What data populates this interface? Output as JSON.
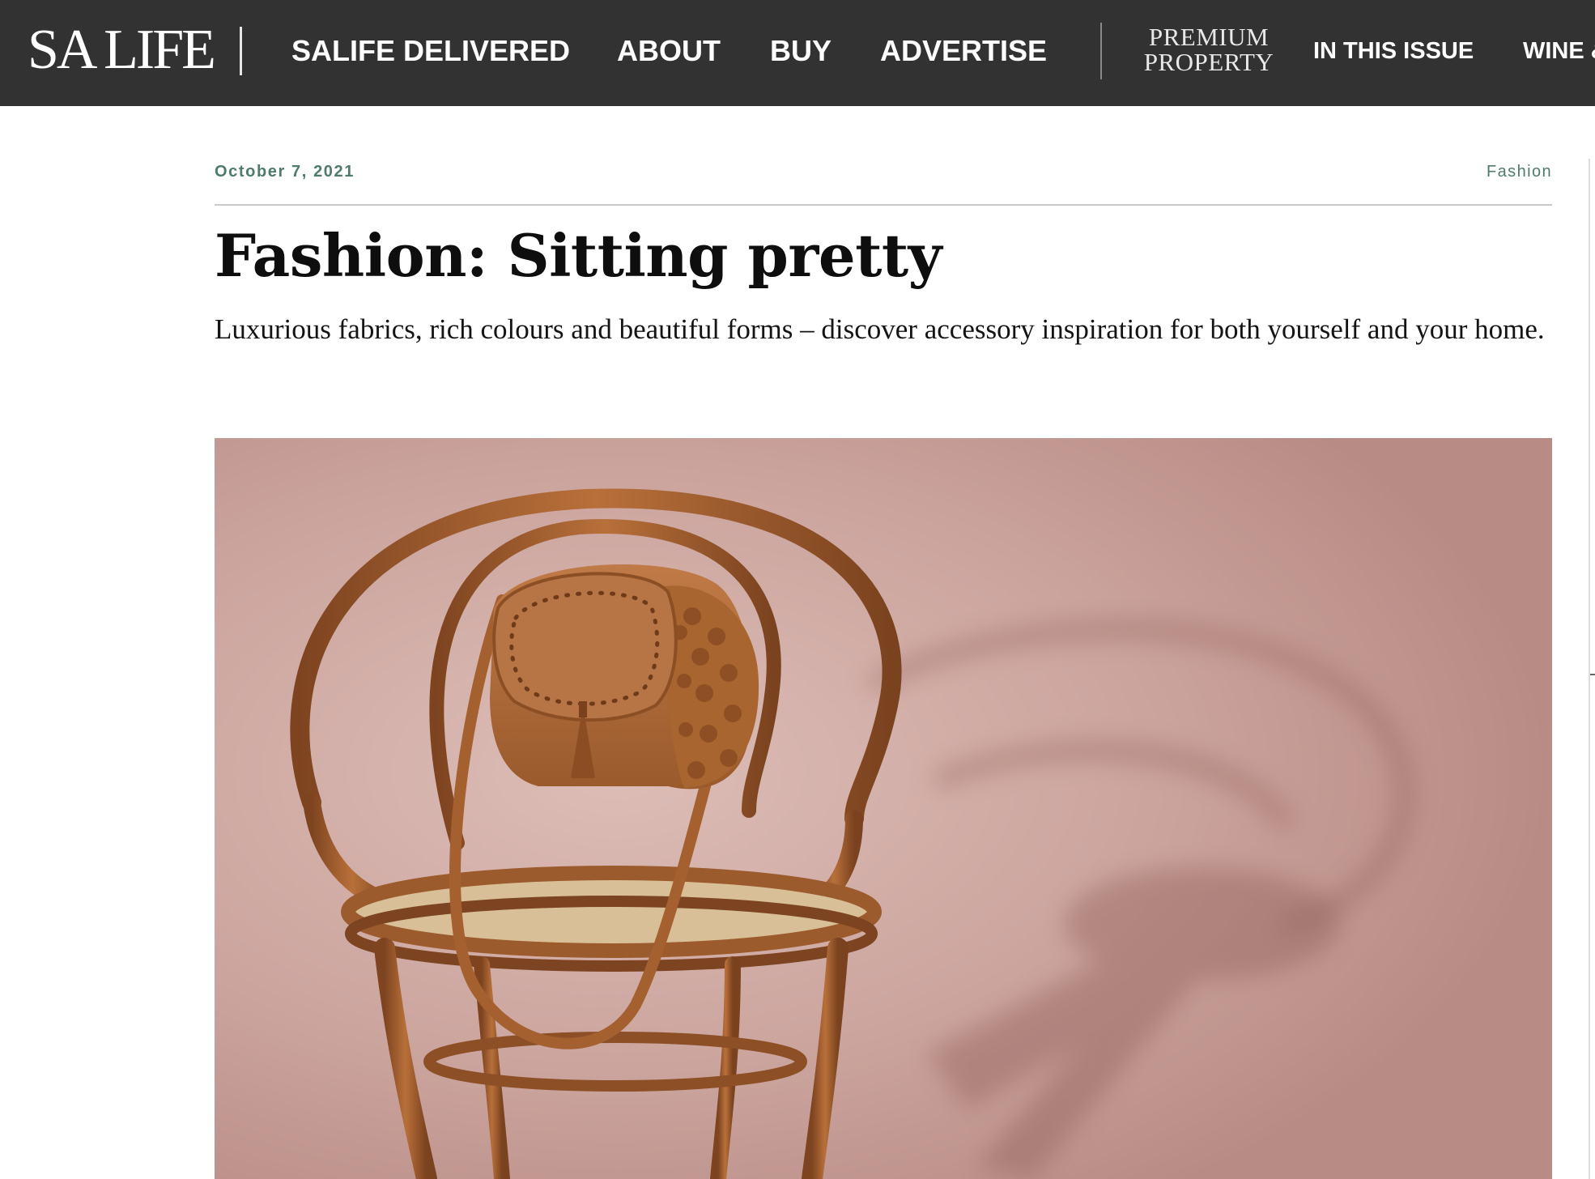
{
  "header": {
    "logo_text": "SA LIFE",
    "nav_items": [
      {
        "label": "SALIFE DELIVERED"
      },
      {
        "label": "ABOUT"
      },
      {
        "label": "BUY"
      },
      {
        "label": "ADVERTISE"
      }
    ],
    "premium_property": {
      "line1": "PREMIUM",
      "line2": "PROPERTY"
    },
    "secondary_nav": [
      {
        "label": "IN THIS ISSUE"
      },
      {
        "label": "WINE &"
      }
    ],
    "colors": {
      "bar": "#323232",
      "text": "#ffffff"
    }
  },
  "article": {
    "date": "October 7, 2021",
    "category": "Fashion",
    "title": "Fashion: Sitting pretty",
    "standfirst": "Luxurious fabrics, rich colours and beautiful forms – discover accessory inspiration for both yourself and your home.",
    "accent_color": "#4f7a6c"
  },
  "hero_image": {
    "subject": "Tan suede and crochet saddle bag resting on a bentwood cane chair against a dusty pink backdrop",
    "colors": {
      "background": "#cfa9a2",
      "wood": "#a8622e",
      "bag": "#b5703f"
    }
  }
}
